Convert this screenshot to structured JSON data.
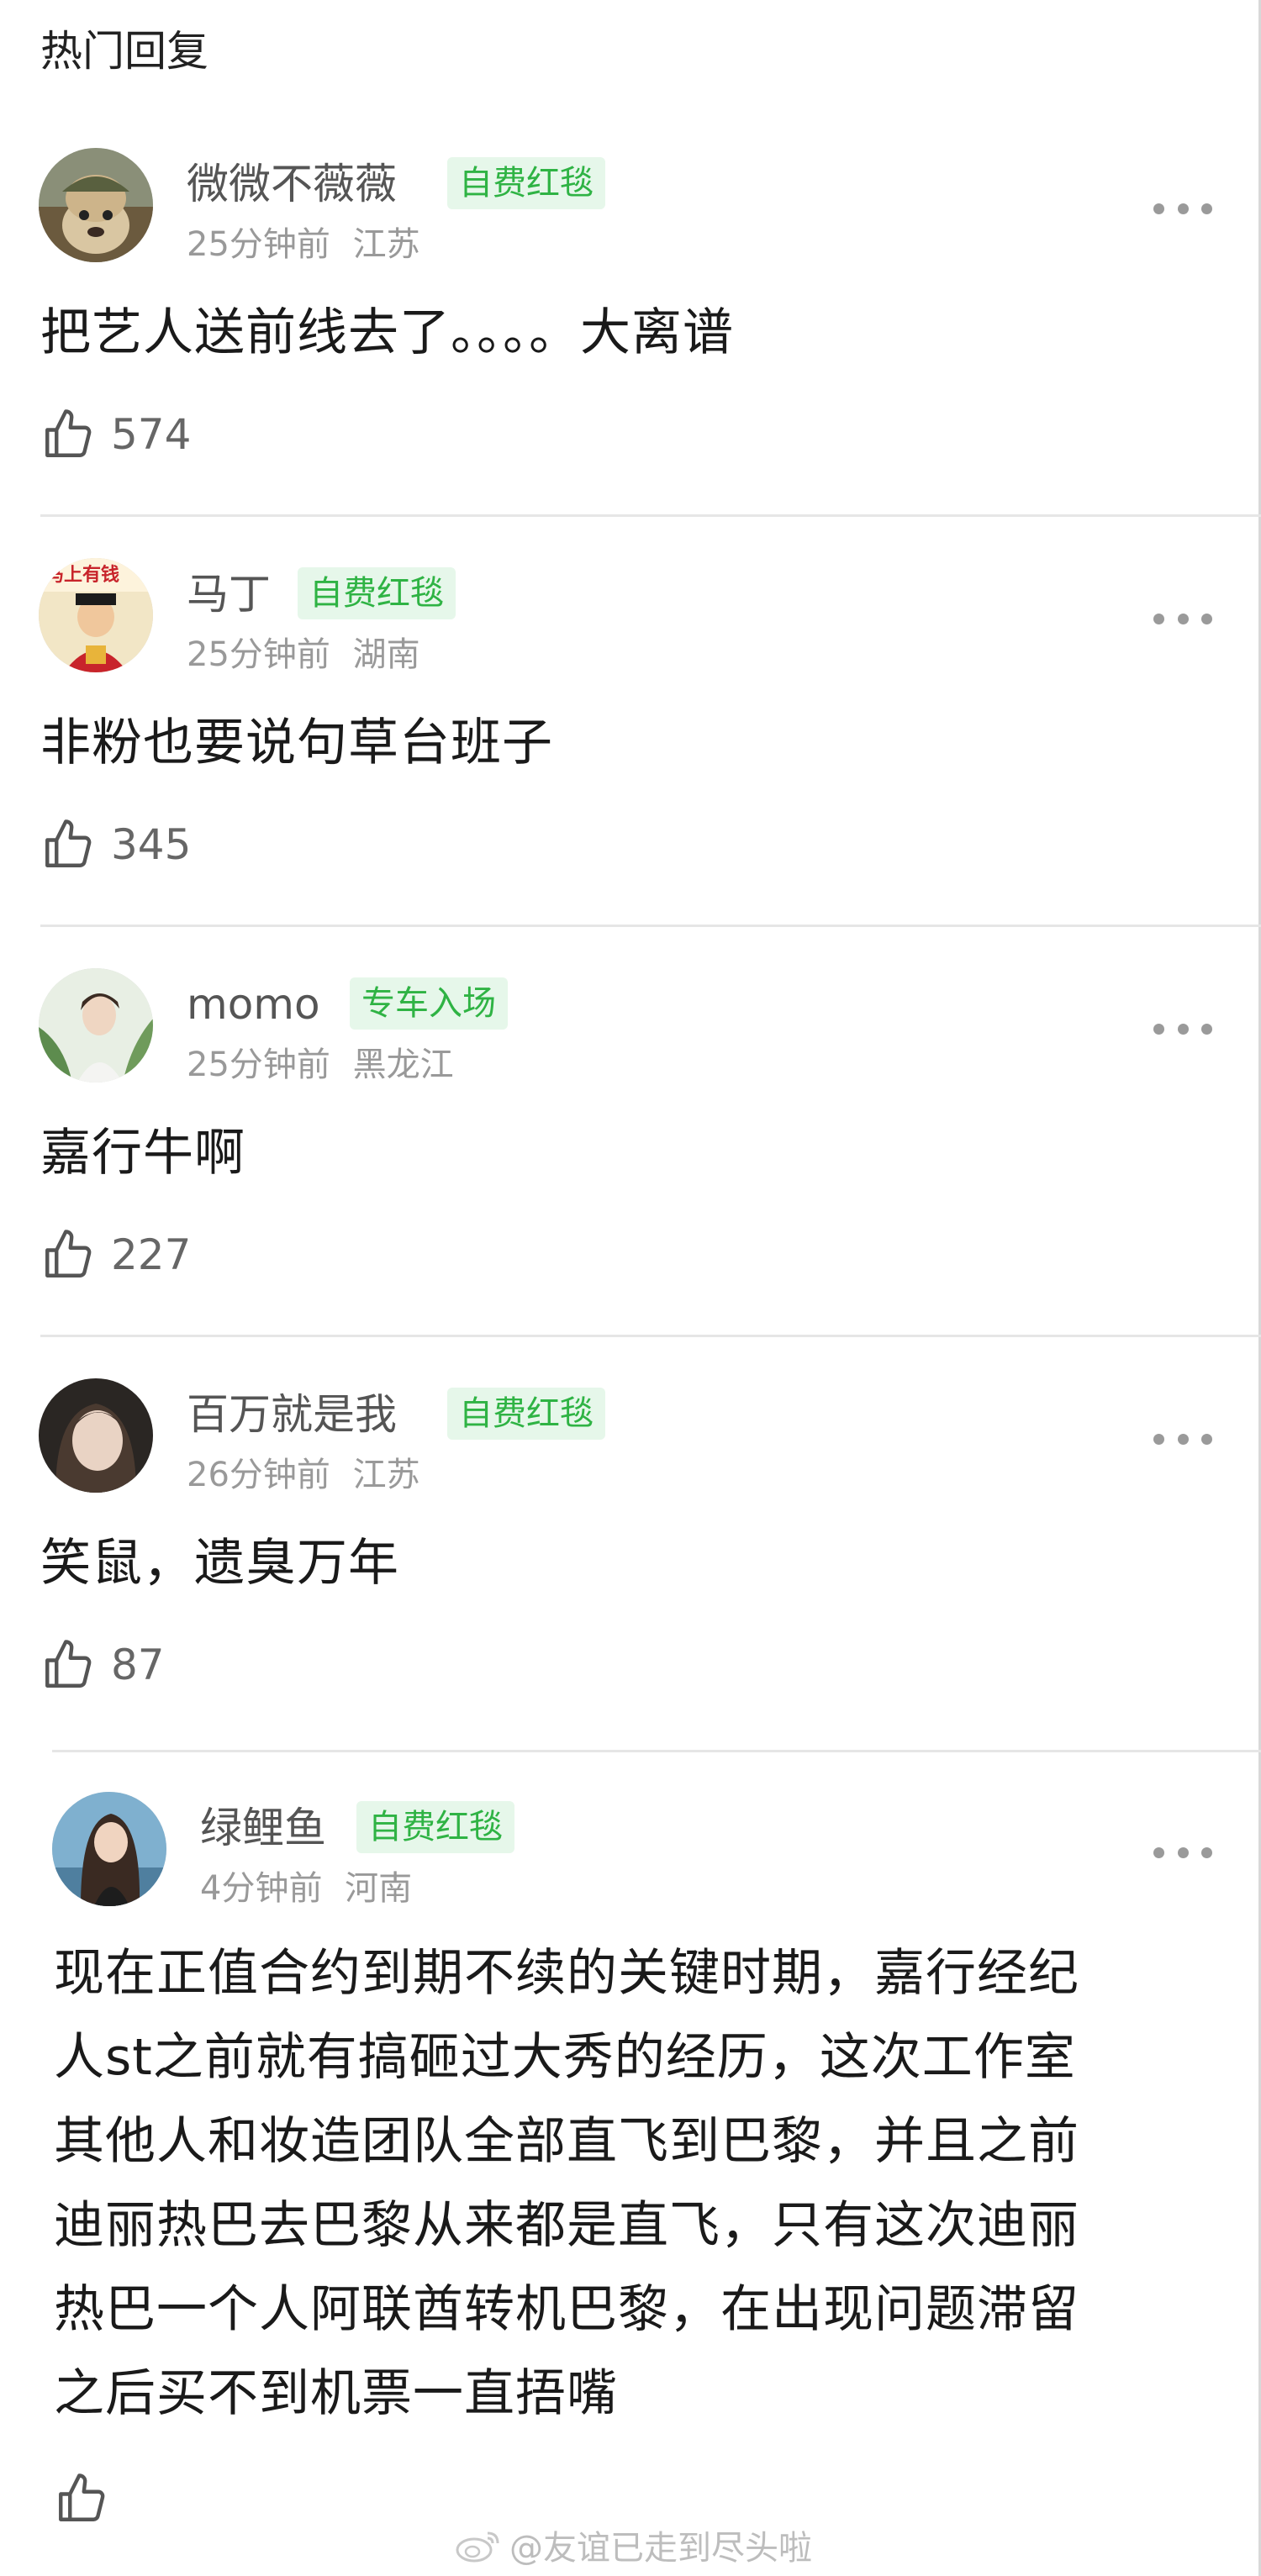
{
  "header": {
    "title": "热门回复"
  },
  "comments": [
    {
      "username": "微微不薇薇",
      "badge": "自费红毯",
      "time": "25分钟前",
      "location": "江苏",
      "text": "把艺人送前线去了。。。。大离谱",
      "likes": "574"
    },
    {
      "username": "马丁",
      "badge": "自费红毯",
      "time": "25分钟前",
      "location": "湖南",
      "text": "非粉也要说句草台班子",
      "likes": "345",
      "avatar_caption": "马上有钱"
    },
    {
      "username": "momo",
      "badge": "专车入场",
      "time": "25分钟前",
      "location": "黑龙江",
      "text": "嘉行牛啊",
      "likes": "227"
    },
    {
      "username": "百万就是我",
      "badge": "自费红毯",
      "time": "26分钟前",
      "location": "江苏",
      "text": "笑鼠，遗臭万年",
      "likes": "87"
    },
    {
      "username": "绿鲤鱼",
      "badge": "自费红毯",
      "time": "4分钟前",
      "location": "河南",
      "text_lines": [
        "现在正值合约到期不续的关键时期，嘉行经纪",
        "人st之前就有搞砸过大秀的经历，这次工作室",
        "其他人和妆造团队全部直飞到巴黎，并且之前",
        "迪丽热巴去巴黎从来都是直飞，只有这次迪丽",
        "热巴一个人阿联酋转机巴黎，在出现问题滞留",
        "之后买不到机票一直捂嘴"
      ],
      "likes": ""
    }
  ],
  "watermark": {
    "text": "@友谊已走到尽头啦"
  },
  "colors": {
    "badge_bg": "#e6f7ea",
    "badge_text": "#2fb344",
    "meta_text": "#999999",
    "divider": "#e6e6e6"
  },
  "icons": {
    "like": "thumbs-up-icon",
    "more": "more-dots-icon",
    "watermark": "weibo-logo-icon"
  }
}
